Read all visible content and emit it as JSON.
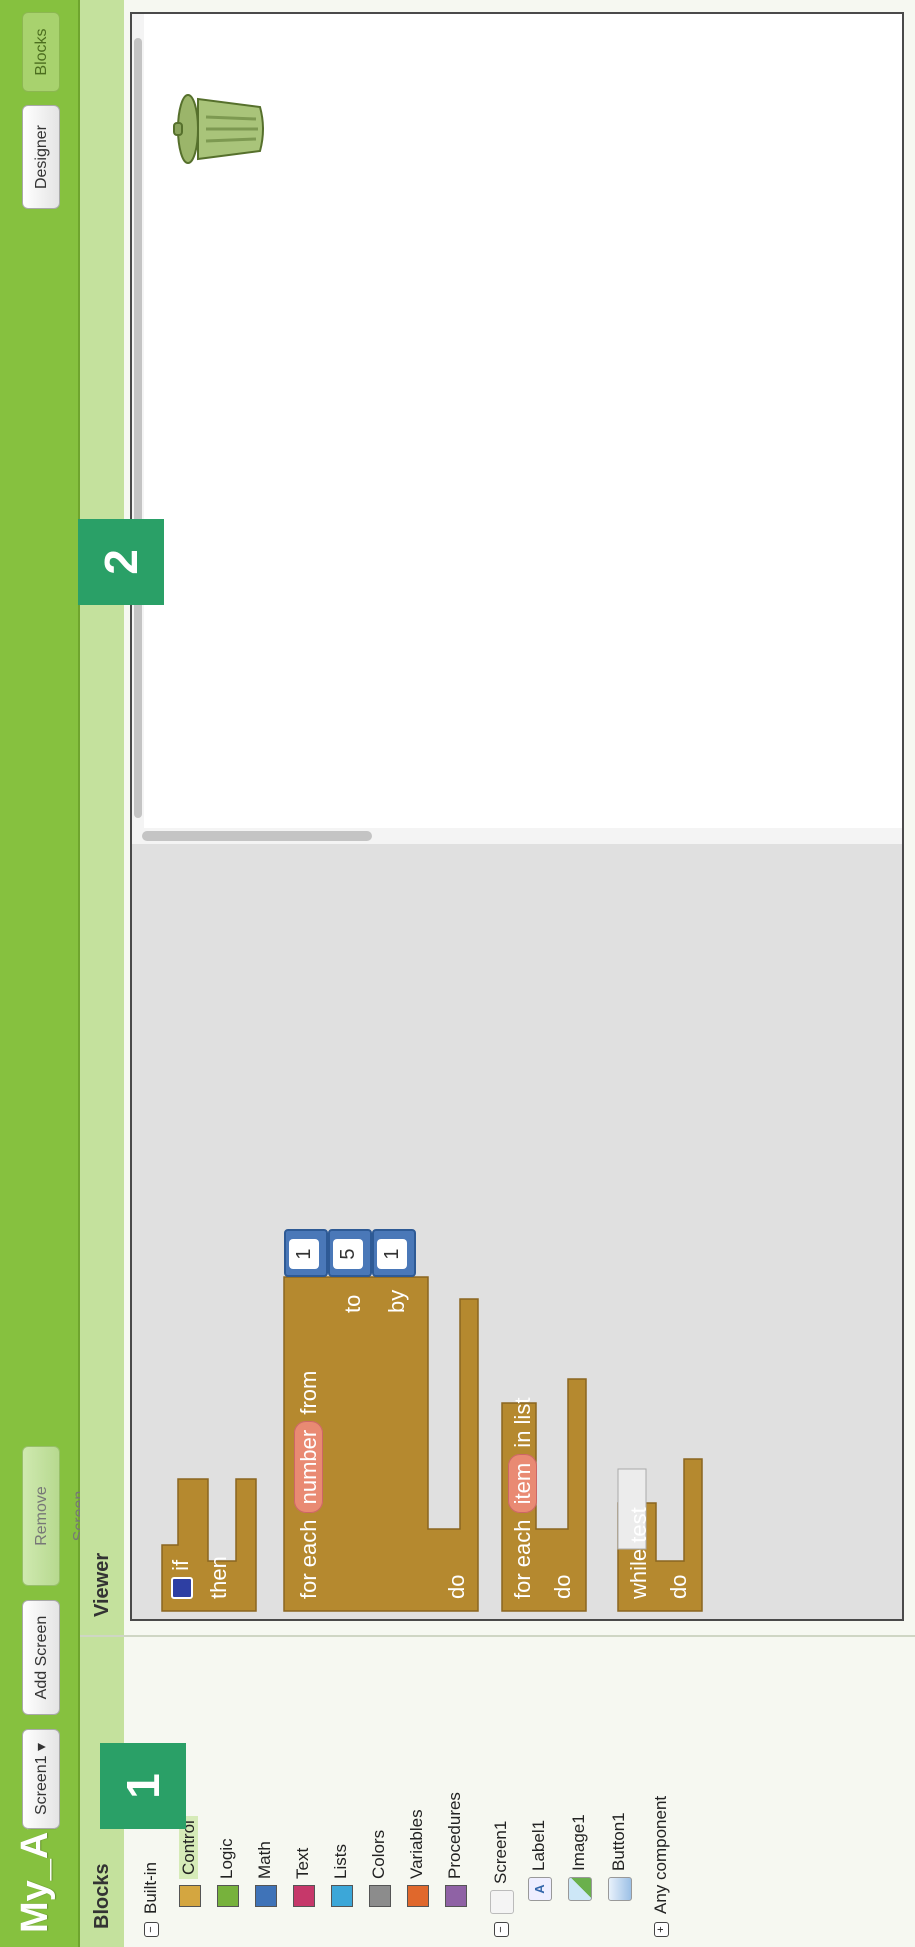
{
  "app": {
    "title": "My_App"
  },
  "toolbar": {
    "screen_select": "Screen1 ▾",
    "add_screen": "Add Screen ...",
    "remove_screen": "Remove Screen",
    "designer": "Designer",
    "blocks": "Blocks"
  },
  "blocks_panel": {
    "title": "Blocks",
    "builtin": {
      "label": "Built-in",
      "toggle": "−",
      "items": [
        {
          "label": "Control",
          "color": "#d4a640",
          "selected": true
        },
        {
          "label": "Logic",
          "color": "#77b23c"
        },
        {
          "label": "Math",
          "color": "#3f73b8"
        },
        {
          "label": "Text",
          "color": "#c6386a"
        },
        {
          "label": "Lists",
          "color": "#3ca7d8"
        },
        {
          "label": "Colors",
          "color": "#8c8c8c"
        },
        {
          "label": "Variables",
          "color": "#e0682c"
        },
        {
          "label": "Procedures",
          "color": "#8f62a5"
        }
      ]
    },
    "screen": {
      "label": "Screen1",
      "toggle": "−",
      "components": [
        {
          "label": "Label1",
          "icon": "label-icon"
        },
        {
          "label": "Image1",
          "icon": "image-icon"
        },
        {
          "label": "Button1",
          "icon": "button-icon"
        }
      ]
    },
    "any_component": {
      "label": "Any component",
      "toggle": "+"
    }
  },
  "viewer": {
    "title": "Viewer",
    "blocks": {
      "if_block": {
        "if": "if",
        "then": "then"
      },
      "for_range": {
        "prefix": "for each",
        "var": "number",
        "from": "from",
        "to": "to",
        "by": "by",
        "do": "do",
        "from_val": "1",
        "to_val": "5",
        "by_val": "1"
      },
      "for_list": {
        "prefix": "for each",
        "var": "item",
        "in_list": "in list",
        "do": "do"
      },
      "while_block": {
        "while": "while",
        "test": "test",
        "do": "do"
      }
    }
  },
  "callouts": {
    "one": "1",
    "two": "2"
  },
  "colors": {
    "accent": "#86c13f",
    "control_block": "#b5892f",
    "math_block": "#4a78b8",
    "callout": "#2aa067"
  }
}
